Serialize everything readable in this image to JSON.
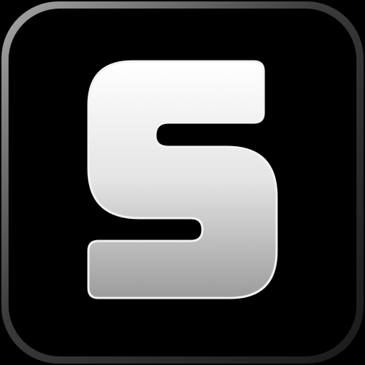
{
  "app_icon": {
    "glyph": "S",
    "icon_name": "s-letter-app-icon",
    "colors": {
      "background": "#000000",
      "bezel_light": "#9a9a9a",
      "bezel_dark": "#2a2a2a",
      "glyph_top": "#ffffff",
      "glyph_bottom": "#9c9c9c",
      "glyph_outline": "#f2f2f2"
    }
  }
}
